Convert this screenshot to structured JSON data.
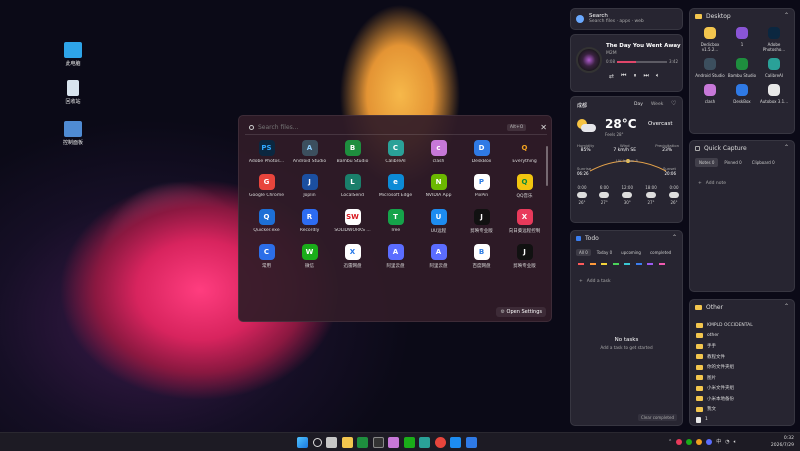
{
  "desktop": {
    "icons": [
      {
        "label": "此电脑"
      },
      {
        "label": "回收站"
      },
      {
        "label": "控制面板"
      }
    ]
  },
  "launcher": {
    "search_placeholder": "Search files...",
    "shortcut": "Alt+O",
    "open_settings": "Open Settings",
    "apps": [
      {
        "label": "Adobe Photos...",
        "icon": "PS",
        "color": "#0b2740",
        "fg": "#31a8ff"
      },
      {
        "label": "Android Studio",
        "icon": "A",
        "color": "#3c4f5e",
        "fg": "#8fd0ff"
      },
      {
        "label": "Bambu Studio",
        "icon": "B",
        "color": "#1e8e3e",
        "fg": "#fff"
      },
      {
        "label": "CalibreAI",
        "icon": "C",
        "color": "#2aa198",
        "fg": "#fff"
      },
      {
        "label": "clash",
        "icon": "c",
        "color": "#c778d8",
        "fg": "#fff"
      },
      {
        "label": "DeskBox",
        "icon": "D",
        "color": "#2f7ae5",
        "fg": "#fff"
      },
      {
        "label": "Everything",
        "icon": "Q",
        "color": "transparent",
        "fg": "#f0a020"
      },
      {
        "label": "Google Chrome",
        "icon": "G",
        "color": "#e8453c",
        "fg": "#fff"
      },
      {
        "label": "Joplin",
        "icon": "J",
        "color": "#1b4fa0",
        "fg": "#fff"
      },
      {
        "label": "LocalSend",
        "icon": "L",
        "color": "#1a7f6b",
        "fg": "#fff"
      },
      {
        "label": "Microsoft Edge",
        "icon": "e",
        "color": "#0c8bd6",
        "fg": "#fff"
      },
      {
        "label": "NVIDIA App",
        "icon": "N",
        "color": "#6bb800",
        "fg": "#fff"
      },
      {
        "label": "PixPin",
        "icon": "P",
        "color": "#ffffff",
        "fg": "#2a7be4"
      },
      {
        "label": "QQ音乐",
        "icon": "Q",
        "color": "#f2c50f",
        "fg": "#0a8a3a"
      },
      {
        "label": "Quicker.exe",
        "icon": "Q",
        "color": "#1d6fd6",
        "fg": "#fff"
      },
      {
        "label": "Recordly",
        "icon": "R",
        "color": "#2d6cf2",
        "fg": "#fff"
      },
      {
        "label": "SOLIDWORKS ...",
        "icon": "SW",
        "color": "#ffffff",
        "fg": "#d8161d"
      },
      {
        "label": "Tree",
        "icon": "T",
        "color": "#15a34a",
        "fg": "#fff"
      },
      {
        "label": "UU远程",
        "icon": "U",
        "color": "#1d8cf0",
        "fg": "#fff"
      },
      {
        "label": "剪映专业版",
        "icon": "J",
        "color": "#111111",
        "fg": "#fff"
      },
      {
        "label": "向日葵远程控制",
        "icon": "X",
        "color": "#e83a5b",
        "fg": "#fff"
      },
      {
        "label": "常用",
        "icon": "C",
        "color": "#2c6ee8",
        "fg": "#fff"
      },
      {
        "label": "微信",
        "icon": "W",
        "color": "#1aad19",
        "fg": "#fff"
      },
      {
        "label": "迅雷网盘",
        "icon": "X",
        "color": "#ffffff",
        "fg": "#1f74e8"
      },
      {
        "label": "阿里云盘",
        "icon": "A",
        "color": "#5b6dff",
        "fg": "#fff"
      },
      {
        "label": "阿里云盘",
        "icon": "A",
        "color": "#5b6dff",
        "fg": "#fff"
      },
      {
        "label": "百度网盘",
        "icon": "B",
        "color": "#ffffff",
        "fg": "#2a7be4"
      },
      {
        "label": "剪映专业版",
        "icon": "J",
        "color": "#111111",
        "fg": "#fff"
      }
    ]
  },
  "search_widget": {
    "title": "Search",
    "subtitle": "Search files · apps · web"
  },
  "music": {
    "title": "The Day You Went Away",
    "artist": "M2M",
    "elapsed": "0:08",
    "total": "3:42",
    "progress": 0.38
  },
  "weather": {
    "city": "成都",
    "tab_day": "Day",
    "tab_week": "Week",
    "temp": "28°C",
    "condition": "Overcast",
    "feels": "Feels 28°",
    "stats": [
      {
        "label": "Humidity",
        "value": "85%"
      },
      {
        "label": "Wind",
        "value": "7 km/h SE"
      },
      {
        "label": "Precipitation",
        "value": "23%"
      }
    ],
    "sunrise_label": "Sunrise",
    "sunrise": "06:26",
    "sunset_label": "Sunset",
    "sunset": "20:06",
    "uv": "UV Index: 5",
    "hours": [
      {
        "t": "0:00",
        "v": "26°"
      },
      {
        "t": "6:00",
        "v": "27°"
      },
      {
        "t": "12:00",
        "v": "30°"
      },
      {
        "t": "18:00",
        "v": "27°"
      },
      {
        "t": "0:00",
        "v": "26°"
      }
    ]
  },
  "desktop_panel": {
    "title": "Desktop",
    "items": [
      {
        "label": "Dedicbox v1.5.2...",
        "icon": "folder"
      },
      {
        "label": "1",
        "icon": "file"
      },
      {
        "label": "Adobe Photosho...",
        "icon": "ps"
      },
      {
        "label": "Android Studio",
        "icon": "as"
      },
      {
        "label": "Bambu Studio",
        "icon": "bb"
      },
      {
        "label": "CalibreAI",
        "icon": "ca"
      },
      {
        "label": "clash",
        "icon": "cl"
      },
      {
        "label": "DeskBox",
        "icon": "db"
      },
      {
        "label": "Autobox 3.1...",
        "icon": "doc"
      }
    ]
  },
  "quick_capture": {
    "title": "Quick Capture",
    "tabs": [
      "Notes 0",
      "Pinned 0",
      "Clipboard 0"
    ],
    "add_note": "Add note"
  },
  "todo": {
    "title": "Todo",
    "tabs": [
      "All 0",
      "Today 0",
      "upcoming",
      "completed"
    ],
    "add_task": "Add a task",
    "empty_title": "No tasks",
    "empty_sub": "Add a task to get started",
    "clear": "Clear completed"
  },
  "other_panel": {
    "title": "Other",
    "items": [
      "KMPLD OCCIDENTAL",
      "other",
      "手手",
      "教程文件",
      "你的文件夹组",
      "图片",
      "小米文件夹组",
      "小米本地备份",
      "我文",
      "1"
    ]
  },
  "taskbar": {
    "time": "0:32",
    "date": "2026/7/29",
    "tray": "中"
  }
}
